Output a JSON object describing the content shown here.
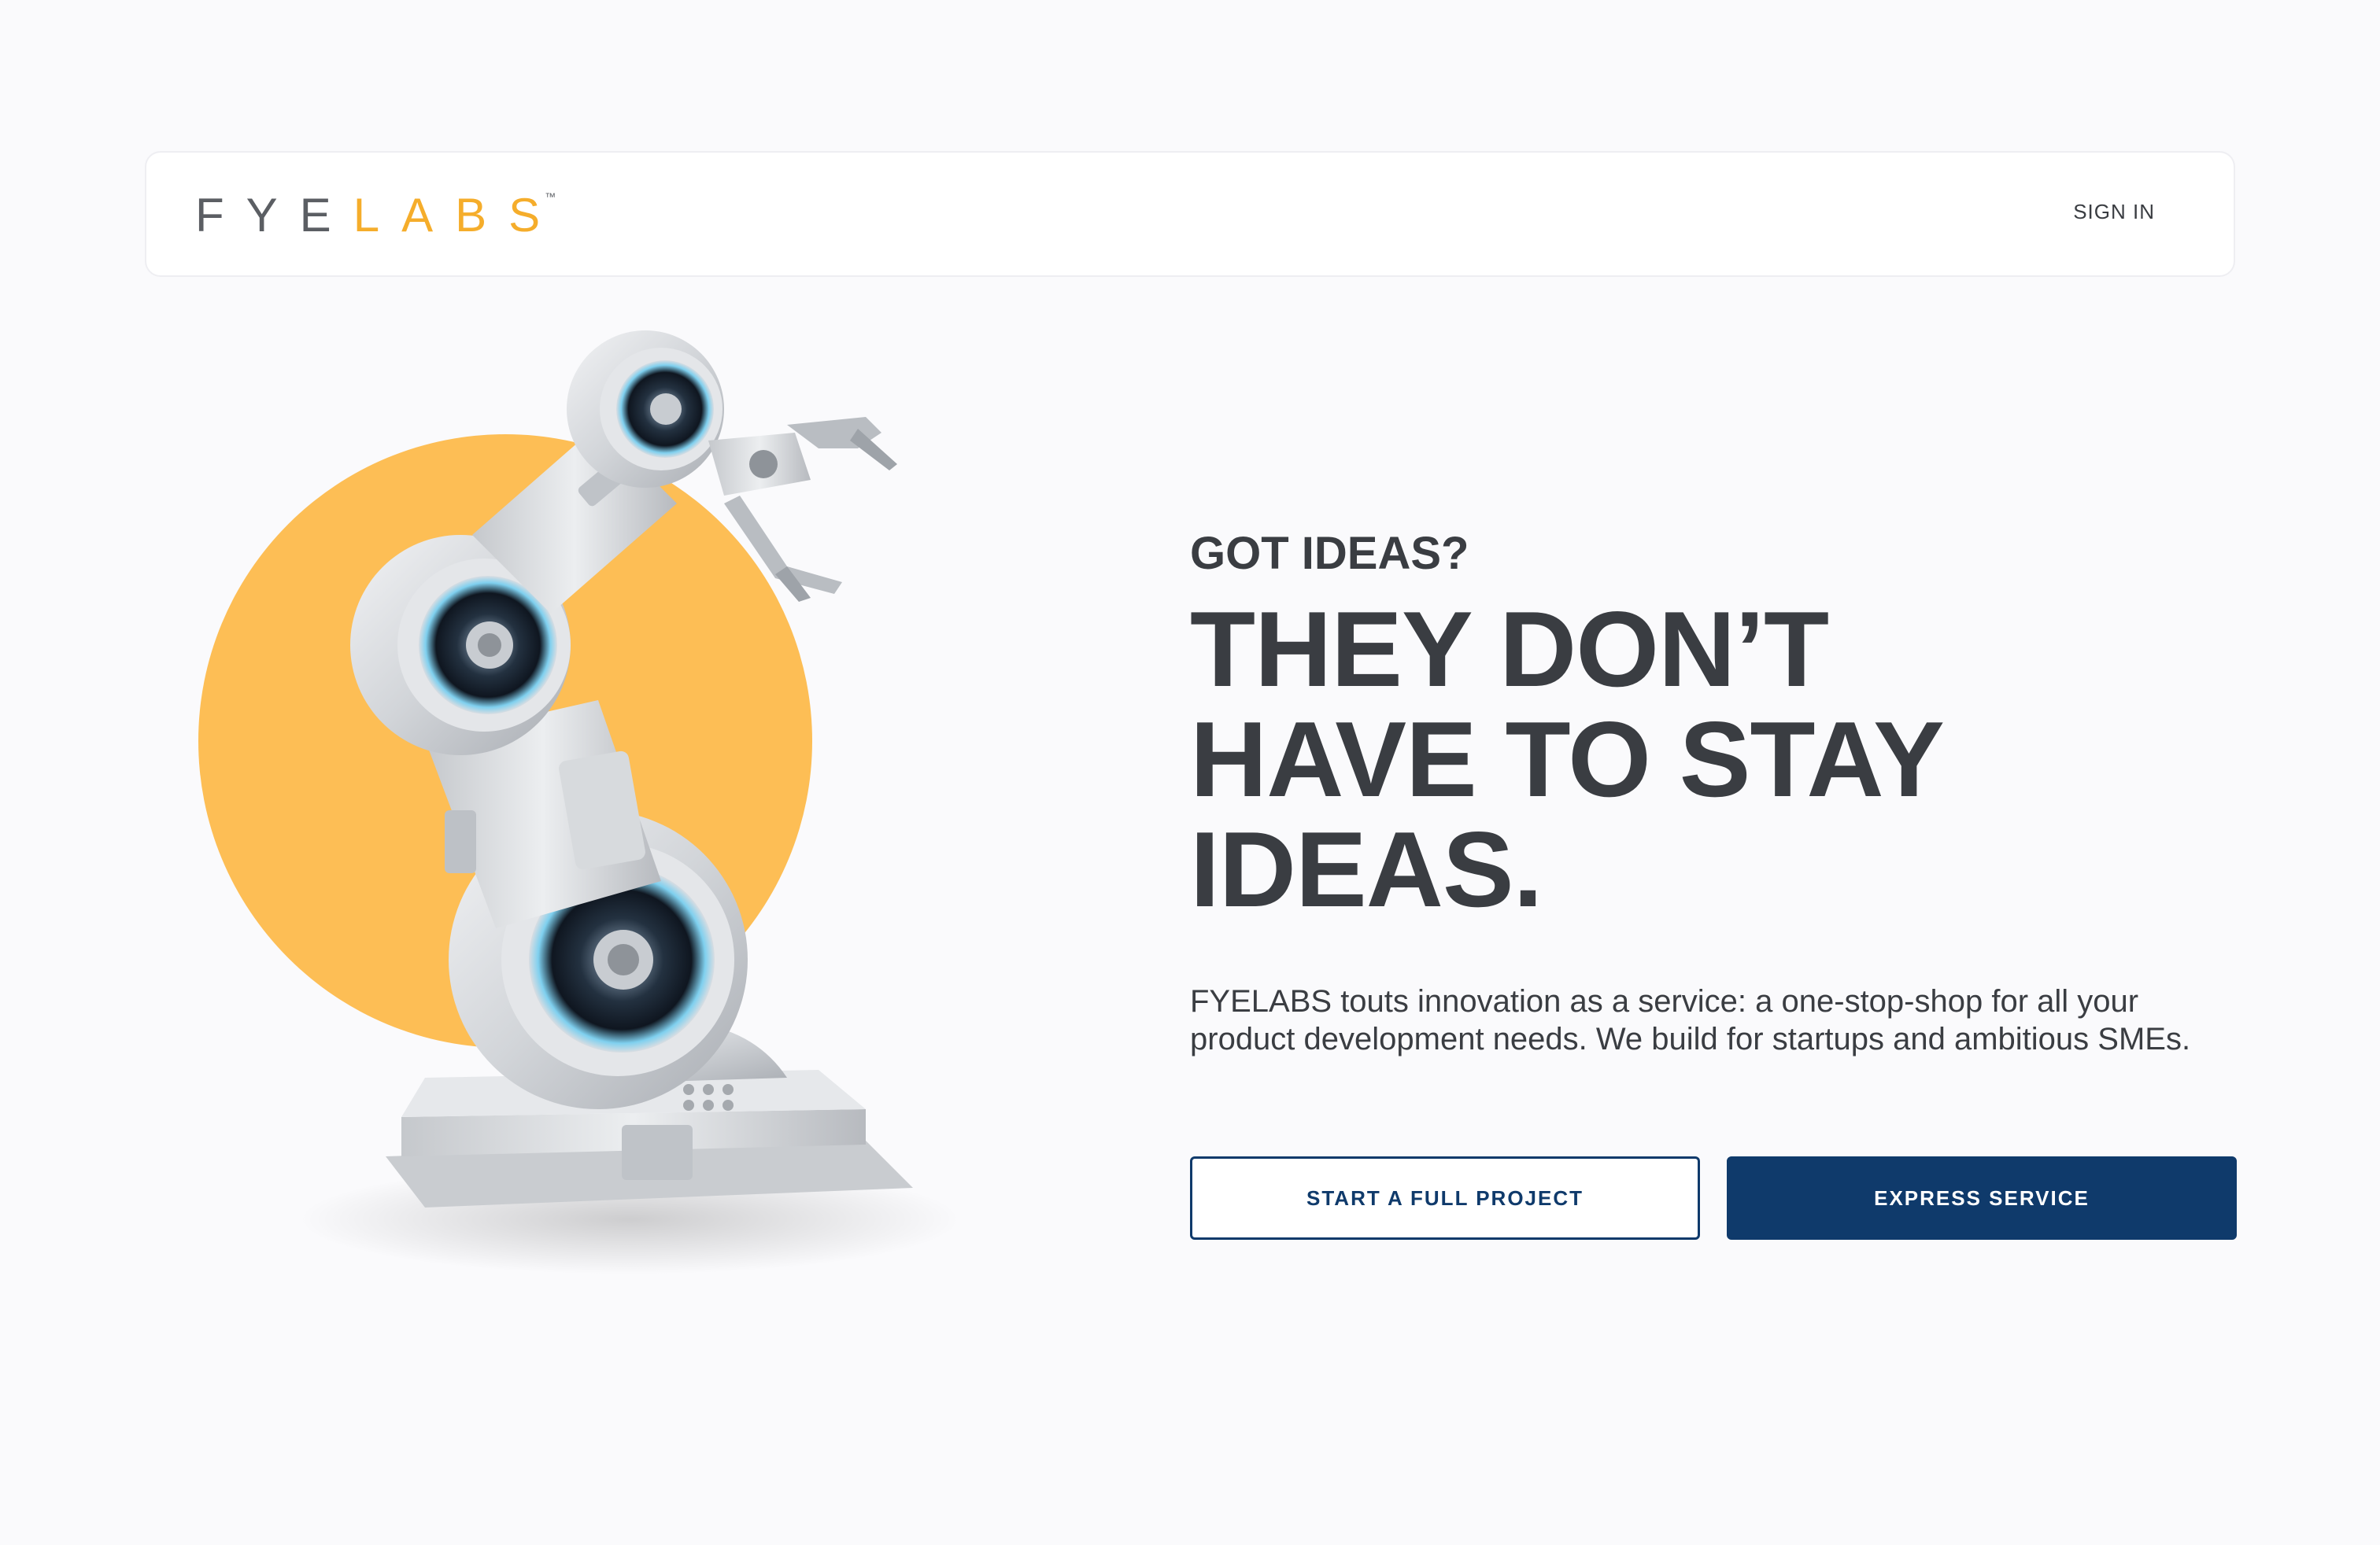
{
  "header": {
    "logo": {
      "part1": "FYE",
      "part2": "LABS",
      "tm": "™"
    },
    "signin_label": "SIGN IN"
  },
  "hero": {
    "eyebrow": "GOT IDEAS?",
    "headline_lines": [
      "THEY DON’T",
      "HAVE TO STAY",
      "IDEAS."
    ],
    "description": "FYELABS touts innovation as a service: a one-stop-shop for all your product development needs. We build for startups and ambitious SMEs.",
    "buttons": {
      "full_project": "START A FULL PROJECT",
      "express": "EXPRESS SERVICE"
    },
    "image": "robot-arm-illustration"
  },
  "colors": {
    "accent_amber": "#fdbe55",
    "navy": "#0f3a6b",
    "text_dark": "#3a3d42",
    "background": "#fafafc"
  }
}
